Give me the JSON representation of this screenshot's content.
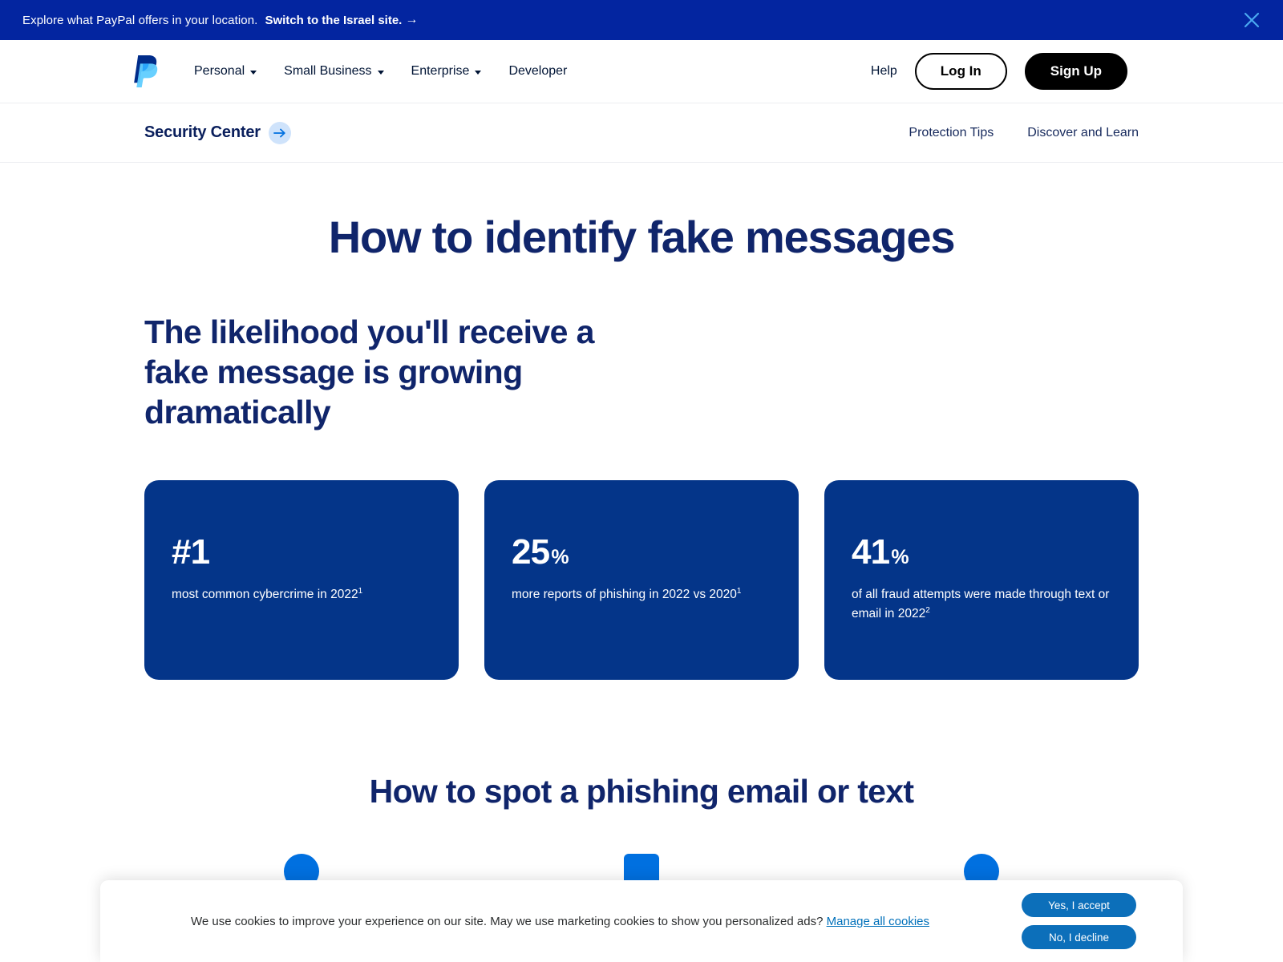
{
  "location_banner": {
    "text": "Explore what PayPal offers in your location.",
    "link_label": "Switch to the Israel site.",
    "arrow_glyph": "→",
    "close_icon": "close-icon",
    "background_color": "#0325a0",
    "close_color": "#4aa8f0"
  },
  "main_nav": {
    "logo_icon": "paypal-logo-icon",
    "links": [
      {
        "label": "Personal",
        "has_dropdown": true
      },
      {
        "label": "Small Business",
        "has_dropdown": true
      },
      {
        "label": "Enterprise",
        "has_dropdown": true
      },
      {
        "label": "Developer",
        "has_dropdown": false
      }
    ],
    "help_label": "Help",
    "login_label": "Log In",
    "signup_label": "Sign Up"
  },
  "sub_nav": {
    "brand_label": "Security Center",
    "brand_arrow_icon": "arrow-right-icon",
    "links": [
      {
        "label": "Protection Tips"
      },
      {
        "label": "Discover and Learn"
      }
    ]
  },
  "hero": {
    "title": "How to identify fake messages",
    "subtitle": "The likelihood you'll receive a fake message is growing dramatically"
  },
  "stats": [
    {
      "value": "#1",
      "unit": "",
      "description": "most common cybercrime in 2022",
      "footnote": "1"
    },
    {
      "value": "25",
      "unit": "%",
      "description": "more reports of phishing in 2022 vs 2020",
      "footnote": "1"
    },
    {
      "value": "41",
      "unit": "%",
      "description": "of all fraud attempts were made through text or email in 2022",
      "footnote": "2"
    }
  ],
  "section_two": {
    "title": "How to spot a phishing email or text"
  },
  "cookie_banner": {
    "message": "We use cookies to improve your experience on our site. May we use marketing cookies to show you personalized ads?",
    "manage_link": "Manage all cookies",
    "accept_label": "Yes, I accept",
    "decline_label": "No, I decline",
    "button_color": "#0c6fba"
  },
  "colors": {
    "brand_navy": "#10256b",
    "card_blue": "#043589",
    "banner_blue": "#0325a0",
    "link_blue": "#0070ba"
  }
}
